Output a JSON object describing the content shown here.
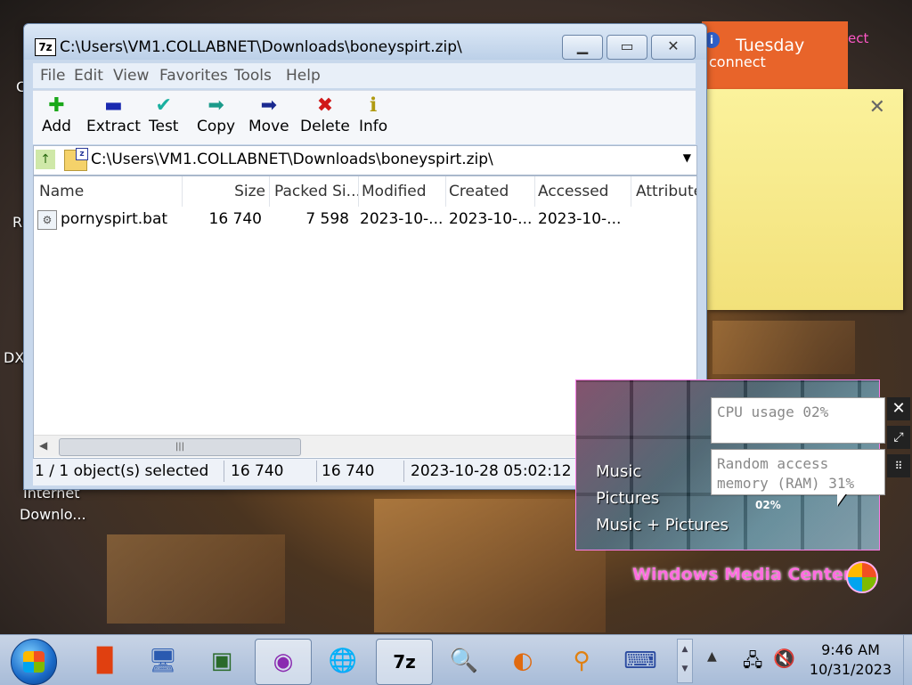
{
  "window": {
    "title": "C:\\Users\\VM1.COLLABNET\\Downloads\\boneyspirt.zip\\",
    "app_icon_text": "7z"
  },
  "menu": [
    "File",
    "Edit",
    "View",
    "Favorites",
    "Tools",
    "Help"
  ],
  "toolbar": {
    "add": "Add",
    "extract": "Extract",
    "test": "Test",
    "copy": "Copy",
    "move": "Move",
    "delete": "Delete",
    "info": "Info"
  },
  "address": "C:\\Users\\VM1.COLLABNET\\Downloads\\boneyspirt.zip\\",
  "columns": [
    "Name",
    "Size",
    "Packed Si...",
    "Modified",
    "Created",
    "Accessed",
    "Attribute"
  ],
  "rows": [
    {
      "name": "pornyspirt.bat",
      "size": "16 740",
      "packed": "7 598",
      "modified": "2023-10-...",
      "created": "2023-10-...",
      "accessed": "2023-10-..."
    }
  ],
  "status": {
    "selected": "1 / 1 object(s) selected",
    "size": "16 740",
    "packed": "16 740",
    "date": "2023-10-28 05:02:12"
  },
  "desktop": {
    "label_internet": "Internet",
    "label_download": "Downlo...",
    "edge_c": "C",
    "edge_r": "R",
    "edge_dx": "DX"
  },
  "calendar": {
    "day": "Tuesday",
    "connect": "connect",
    "side_text": "ect",
    "badge": "i"
  },
  "media_center": {
    "items": [
      "Music",
      "Pictures",
      "Music + Pictures"
    ],
    "brand": "Windows Media Center"
  },
  "cpu_gadget": {
    "cpu_label": "CPU usage 02%",
    "ram_line1": "Random access",
    "ram_line2": "memory (RAM) 31%",
    "percent": "02%"
  },
  "clock": {
    "time": "9:46 AM",
    "date": "10/31/2023"
  },
  "colors": {
    "accent_pink": "#ff6ee0",
    "calendar_orange": "#e8642a",
    "sticky_yellow": "#fbf29c"
  }
}
